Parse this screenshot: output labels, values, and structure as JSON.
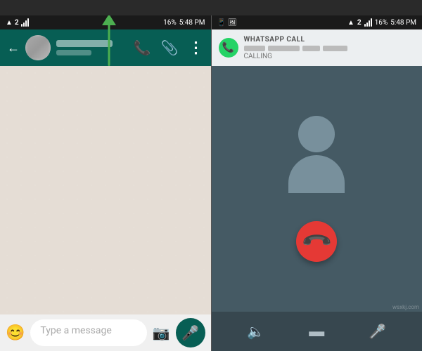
{
  "statusBar": {
    "left": {
      "time": "5:48 PM",
      "icons": [
        "wifi",
        "signal",
        "battery"
      ]
    },
    "right": {
      "time": "5:48 PM",
      "batteryPercent": "16%"
    }
  },
  "leftPanel": {
    "header": {
      "backLabel": "←",
      "phoneIconLabel": "📞",
      "clipIconLabel": "📎",
      "moreIconLabel": "⋮",
      "callTooltip": "Phone call button"
    },
    "chatArea": {
      "placeholder": ""
    },
    "inputBar": {
      "placeholder": "Type a message",
      "emojiIcon": "😊",
      "cameraIcon": "📷",
      "micIcon": "🎤"
    }
  },
  "rightPanel": {
    "notificationBar": {
      "title": "WHATSAPP CALL",
      "callingLabel": "CALLING",
      "nameBlocks": [
        40,
        55,
        35,
        45
      ]
    },
    "callScreen": {
      "avatarAlt": "Contact avatar"
    },
    "actionBar": {
      "speakerIcon": "🔊",
      "videoIcon": "▬",
      "muteIcon": "🎤"
    }
  },
  "arrow": {
    "color": "#4caf50",
    "label": "Arrow pointing to call button"
  },
  "watermark": "wsxkj.com"
}
